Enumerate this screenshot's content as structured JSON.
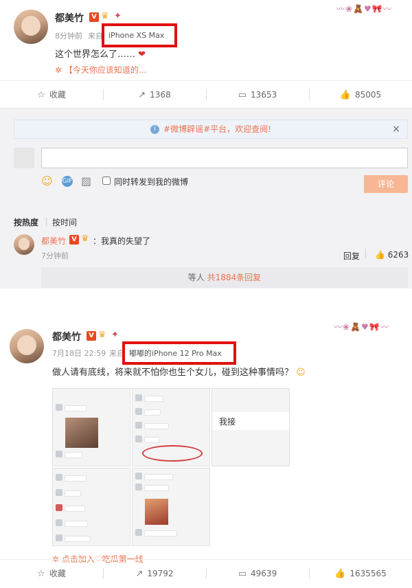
{
  "post1": {
    "username": "都美竹",
    "verified_badge": "V",
    "time": "8分钟前",
    "from_label": "来自",
    "device": "iPhone XS Max",
    "text": "这个世界怎么了……",
    "topic_link": "【今天你应该知道的...",
    "actions": {
      "favorite": "收藏",
      "repost": "1368",
      "comment": "13653",
      "like": "85005"
    }
  },
  "comments": {
    "notice": "#微博辟谣#平台，欢迎查阅!",
    "forward_label": "同时转发到我的微博",
    "submit_label": "评论",
    "sort_hot": "按热度",
    "sort_time": "按时间",
    "item": {
      "username": "都美竹",
      "verified_badge": "V",
      "text": "：我真的失望了",
      "time": "7分钟前",
      "reply_label": "回复",
      "likes": "6263"
    },
    "reply_summary_prefix": "等人",
    "reply_summary_count": "共1884条回复"
  },
  "post2": {
    "username": "都美竹",
    "verified_badge": "V",
    "time": "7月18日 22:59",
    "from_label": "来自",
    "device": "嘟嘟的iPhone 12 Pro Max",
    "text": "做人请有底线，将来就不怕你也生个女儿，碰到这种事情吗？",
    "join_link": "点击加入♡吃瓜第一线",
    "thumb_overlay": "我接",
    "actions": {
      "favorite": "收藏",
      "repost": "19792",
      "comment": "49639",
      "like": "1635565"
    }
  },
  "colors": {
    "accent": "#eb7350",
    "highlight_box": "#e01010",
    "verified": "#e8481f"
  },
  "icons": [
    "star-icon",
    "repost-icon",
    "comment-icon",
    "like-icon",
    "info-icon",
    "close-icon",
    "emoji-icon",
    "gif-icon",
    "image-icon",
    "crown-icon",
    "blossom-icon",
    "heart-emoji-icon",
    "smile-emoji-icon"
  ]
}
